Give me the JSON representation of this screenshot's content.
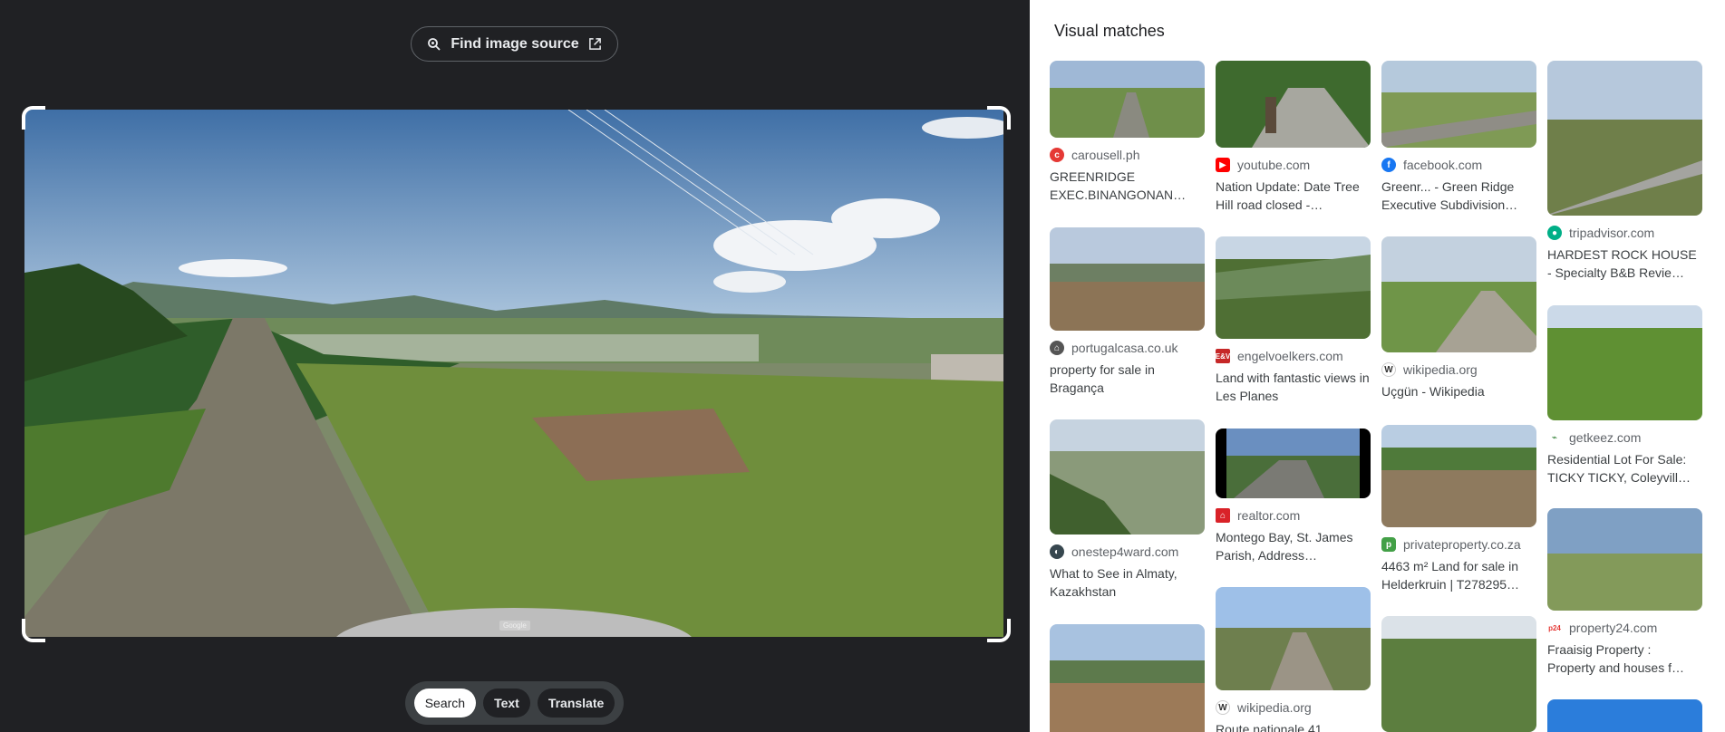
{
  "toolbar": {
    "find_source_label": "Find image source",
    "watermark": "Google"
  },
  "modes": [
    {
      "label": "Search",
      "active": true
    },
    {
      "label": "Text",
      "active": false
    },
    {
      "label": "Translate",
      "active": false
    }
  ],
  "results": {
    "title": "Visual matches",
    "columns": [
      [
        {
          "source": "carousell.ph",
          "icon": "carousell-icon",
          "icon_color": "#e53935",
          "title": "GREENRIDGE EXEC.BINANGONAN…"
        },
        {
          "source": "portugalcasa.co.uk",
          "icon": "house-icon",
          "icon_color": "#555555",
          "title": "property for sale in Bragança"
        },
        {
          "source": "onestep4ward.com",
          "icon": "globe-icon",
          "icon_color": "#37474f",
          "title": "What to See in Almaty, Kazakhstan"
        },
        {
          "source": "",
          "icon": "",
          "icon_color": "",
          "title": ""
        }
      ],
      [
        {
          "source": "youtube.com",
          "icon": "youtube-icon",
          "icon_color": "#ff0000",
          "title": "Nation Update: Date Tree Hill road closed -…"
        },
        {
          "source": "engelvoelkers.com",
          "icon": "ev-icon",
          "icon_color": "#c62828",
          "title": "Land with fantastic views in Les Planes"
        },
        {
          "source": "realtor.com",
          "icon": "realtor-icon",
          "icon_color": "#d92228",
          "title": "Montego Bay, St. James Parish, Address…"
        },
        {
          "source": "wikipedia.org",
          "icon": "wikipedia-icon",
          "icon_color": "#333333",
          "title": "Route nationale 41"
        }
      ],
      [
        {
          "source": "facebook.com",
          "icon": "facebook-icon",
          "icon_color": "#1877f2",
          "title": "Greenr... - Green Ridge Executive Subdivision…"
        },
        {
          "source": "wikipedia.org",
          "icon": "wikipedia-icon",
          "icon_color": "#333333",
          "title": "Uçgün - Wikipedia"
        },
        {
          "source": "privateproperty.co.za",
          "icon": "privateproperty-icon",
          "icon_color": "#43a047",
          "title": "4463 m² Land for sale in Helderkruin | T278295…"
        },
        {
          "source": "",
          "icon": "",
          "icon_color": "",
          "title": ""
        }
      ],
      [
        {
          "source": "tripadvisor.com",
          "icon": "tripadvisor-icon",
          "icon_color": "#00af87",
          "title": "HARDEST ROCK HOUSE - Specialty B&B Revie…"
        },
        {
          "source": "getkeez.com",
          "icon": "keez-icon",
          "icon_color": "#2e7d32",
          "title": "Residential Lot For Sale: TICKY TICKY, Coleyvill…"
        },
        {
          "source": "property24.com",
          "icon": "property24-icon",
          "icon_color": "#e53935",
          "title": "Fraaisig Property : Property and houses f…"
        },
        {
          "source": "",
          "icon": "",
          "icon_color": "",
          "title": ""
        }
      ]
    ]
  }
}
